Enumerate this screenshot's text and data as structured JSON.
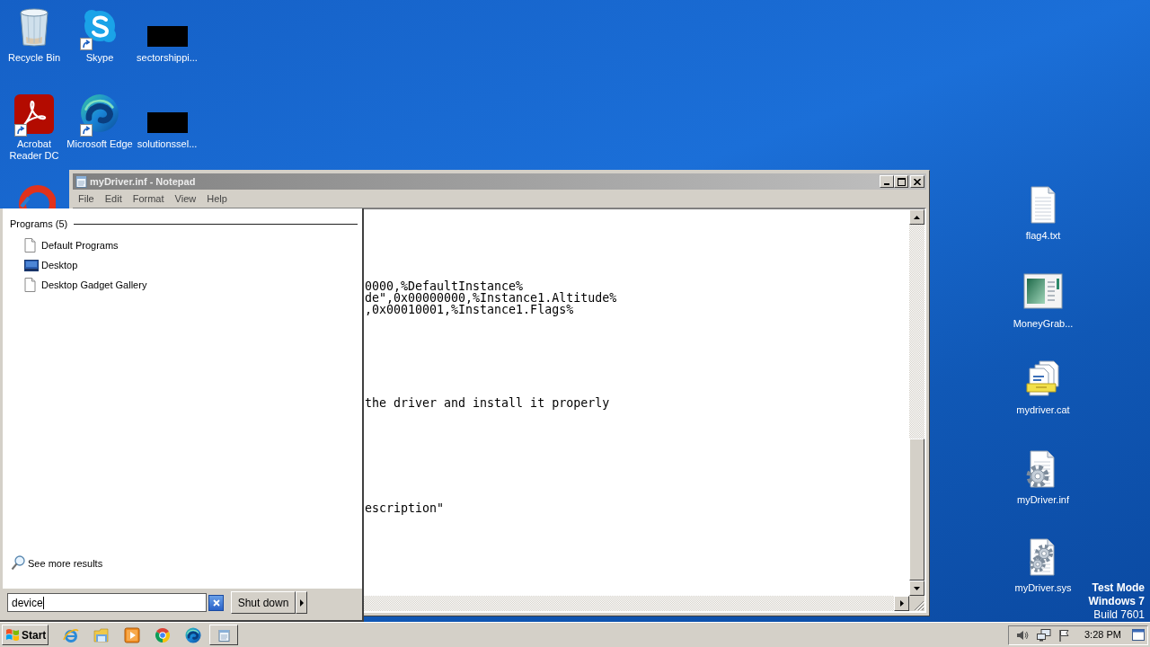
{
  "desktop": {
    "left_icons": [
      {
        "label": "Recycle Bin",
        "kind": "recycle-bin",
        "shortcut": false
      },
      {
        "label": "Skype",
        "kind": "skype",
        "shortcut": true
      },
      {
        "label": "sectorshippi...",
        "kind": "redacted",
        "shortcut": false
      },
      {
        "label": "Acrobat Reader DC",
        "kind": "acrobat",
        "shortcut": true
      },
      {
        "label": "Microsoft Edge",
        "kind": "edge",
        "shortcut": true
      },
      {
        "label": "solutionssel...",
        "kind": "redacted",
        "shortcut": false
      }
    ],
    "right_icons": [
      {
        "label": "flag4.txt",
        "kind": "text-file"
      },
      {
        "label": "MoneyGrab...",
        "kind": "app-window"
      },
      {
        "label": "mydriver.cat",
        "kind": "catalog"
      },
      {
        "label": "myDriver.inf",
        "kind": "setup-file"
      },
      {
        "label": "myDriver.sys",
        "kind": "system-file"
      }
    ],
    "notice": [
      {
        "text": "Test Mode",
        "bold": true
      },
      {
        "text": "Windows 7",
        "bold": true
      },
      {
        "text": "Build 7601",
        "bold": false
      }
    ]
  },
  "notepad": {
    "title": "myDriver.inf - Notepad",
    "active": false,
    "menu": [
      "File",
      "Edit",
      "Format",
      "View",
      "Help"
    ],
    "lines": [
      "0000,%DefaultInstance%",
      "de\",0x00000000,%Instance1.Altitude%",
      ",0x00010001,%Instance1.Flags%",
      "the driver and install it properly",
      "escription\""
    ]
  },
  "start_menu": {
    "section": "Programs (5)",
    "programs": [
      {
        "label": "Default Programs",
        "kind": "document"
      },
      {
        "label": "Desktop",
        "kind": "monitor"
      },
      {
        "label": "Desktop Gadget Gallery",
        "kind": "document"
      }
    ],
    "see_more": "See more results",
    "search": {
      "value": "device"
    },
    "shutdown": "Shut down"
  },
  "taskbar": {
    "start": "Start",
    "clock": "3:28 PM"
  }
}
